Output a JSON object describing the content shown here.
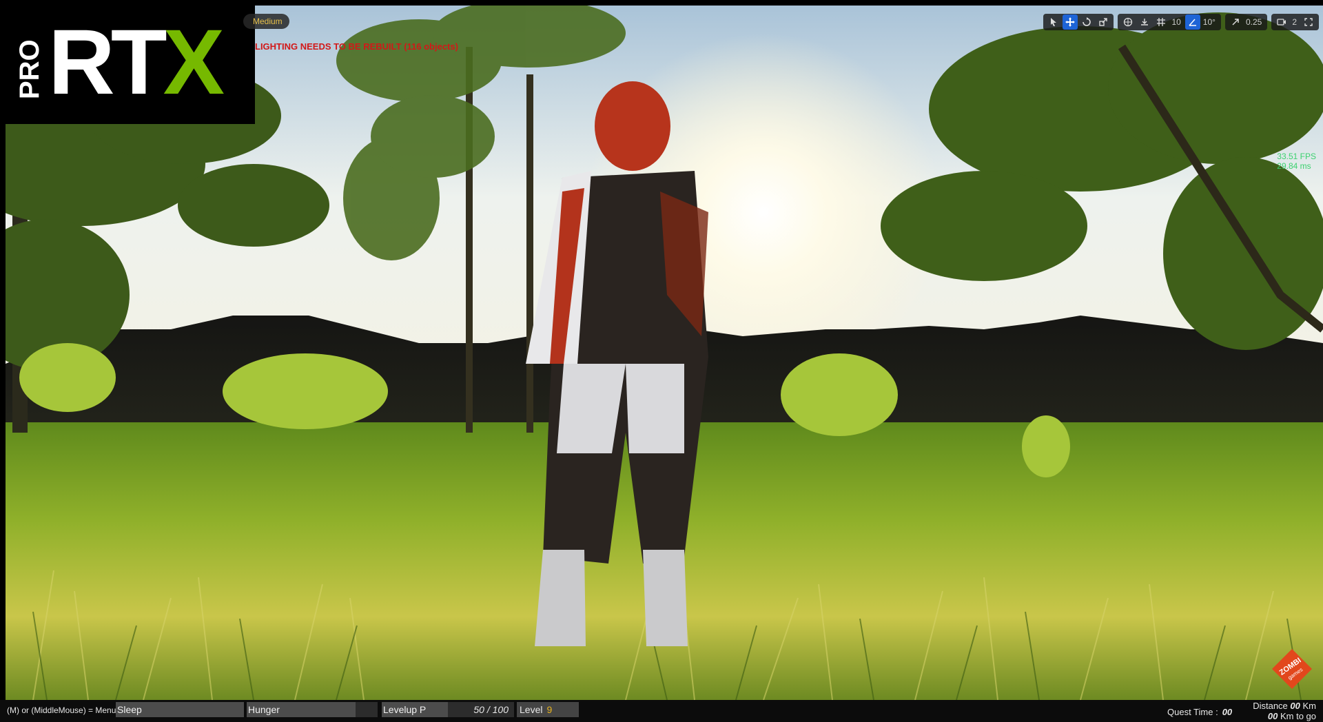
{
  "viewport": {
    "mode_label": "Medium",
    "build_message": "LIGHTING NEEDS TO BE REBUILT (116 objects)",
    "stats": {
      "fps": "33.51 FPS",
      "ms": "29.84 ms"
    }
  },
  "logo": {
    "pro": "PRO",
    "rtx_main": "RT",
    "rtx_accent": "X",
    "accent_color": "#76b900"
  },
  "toolbar": {
    "tools": [
      "select-icon",
      "move-icon",
      "rotate-icon",
      "scale-icon",
      "world-local-icon",
      "surface-snap-icon"
    ],
    "grid_snap": "10",
    "rotation_snap": "10°",
    "scale_snap": "0.25",
    "camera_speed": "2"
  },
  "hud": {
    "menu_hint": "(M) or (MiddleMouse) = Menu",
    "sleep": {
      "label": "Sleep",
      "fill": 1.0
    },
    "hunger": {
      "label": "Hunger",
      "fill": 0.83
    },
    "levelup": {
      "label": "Levelup P",
      "value": "50 / 100",
      "fill": 0.5
    },
    "level": {
      "label": "Level",
      "value": "9"
    },
    "quest_time": {
      "label": "Quest Time :",
      "value": "00"
    },
    "distance": {
      "label": "Distance",
      "value": "00",
      "unit": "Km"
    },
    "to_go": {
      "value": "00",
      "unit": "Km to go"
    }
  },
  "badge": {
    "text": "ZOMBI",
    "subtext": "games"
  }
}
